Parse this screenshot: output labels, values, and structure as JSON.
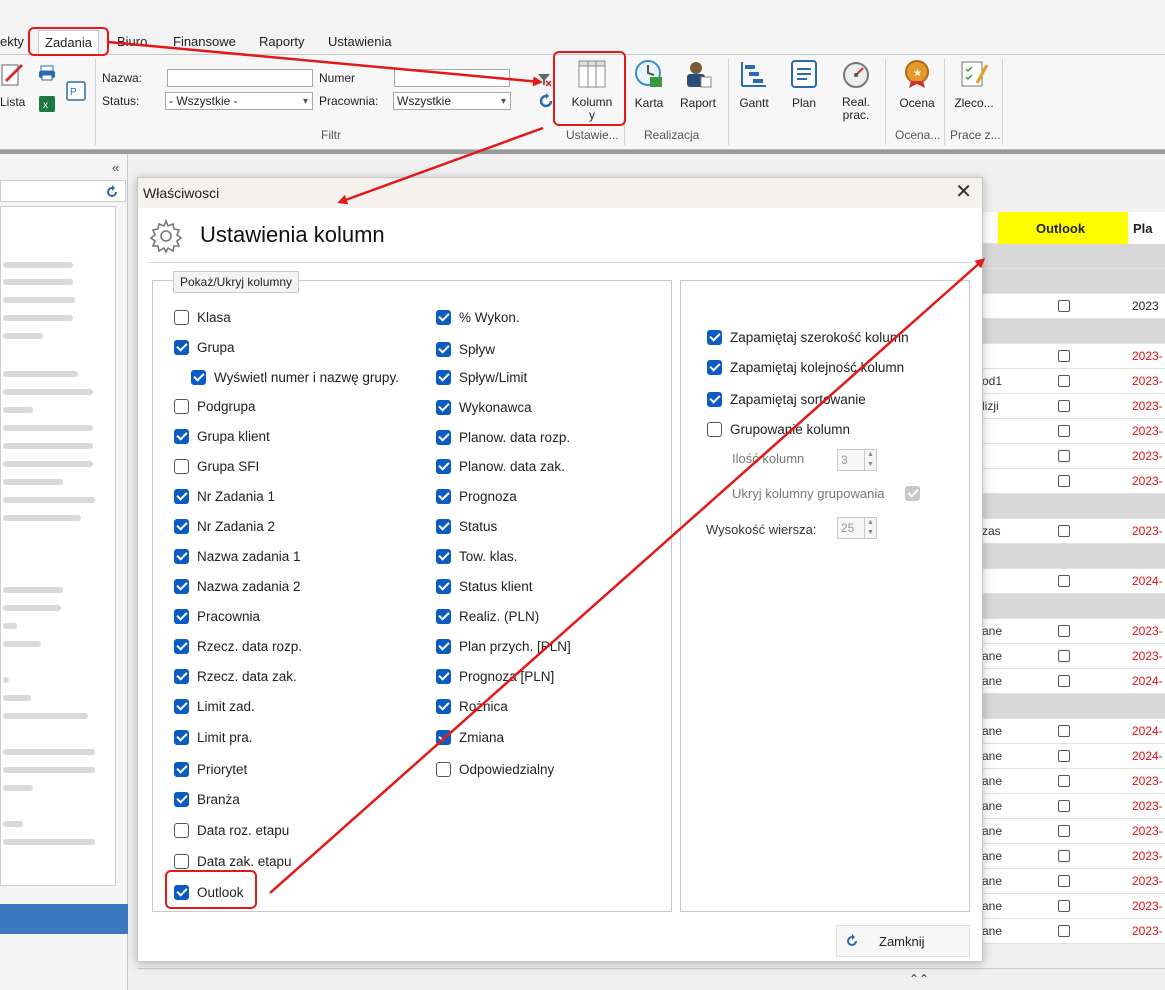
{
  "menu": {
    "tabs": [
      {
        "label": "ekty"
      },
      {
        "label": "Zadania"
      },
      {
        "label": "Biuro"
      },
      {
        "label": "Finansowe"
      },
      {
        "label": "Raporty"
      },
      {
        "label": "Ustawienia"
      }
    ]
  },
  "ribbon": {
    "lista_label": "Lista",
    "filter": {
      "nazwa_label": "Nazwa:",
      "nazwa_value": "",
      "numer_label": "Numer",
      "numer_value": "",
      "status_label": "Status:",
      "status_value": "- Wszystkie -",
      "pracownia_label": "Pracownia:",
      "pracownia_value": "Wszystkie",
      "group_label": "Filtr"
    },
    "buttons": {
      "kolumny": "Kolumn\ny",
      "karta": "Karta",
      "raport": "Raport",
      "gantt": "Gantt",
      "plan": "Plan",
      "real_prac": "Real.\nprac.",
      "ocena": "Ocena",
      "zlecenia": "Zleco..."
    },
    "groups": {
      "ustawienia": "Ustawie...",
      "realizacja": "Realizacja",
      "ocena": "Ocena...",
      "prace": "Prace z..."
    }
  },
  "grid": {
    "header_outlook": "Outlook",
    "header_plan": "Pla",
    "rows": [
      {
        "type": "group",
        "text": "",
        "date": ""
      },
      {
        "type": "group",
        "text": "",
        "date": ""
      },
      {
        "type": "row",
        "text": "",
        "date": "2023",
        "cb": true,
        "date_color": "#222"
      },
      {
        "type": "group",
        "text": "",
        "date": ""
      },
      {
        "type": "row",
        "text": "",
        "date": "2023-",
        "cb": true
      },
      {
        "type": "row",
        "text": "od1",
        "date": "2023-",
        "cb": true
      },
      {
        "type": "row",
        "text": "lizji",
        "date": "2023-",
        "cb": true
      },
      {
        "type": "row",
        "text": "",
        "date": "2023-",
        "cb": true
      },
      {
        "type": "row",
        "text": "",
        "date": "2023-",
        "cb": true
      },
      {
        "type": "row",
        "text": "",
        "date": "2023-",
        "cb": true
      },
      {
        "type": "group",
        "text": "",
        "date": ""
      },
      {
        "type": "row",
        "text": "zas",
        "date": "2023-",
        "cb": true
      },
      {
        "type": "group",
        "text": "",
        "date": ""
      },
      {
        "type": "row",
        "text": "",
        "date": "2024-",
        "cb": true
      },
      {
        "type": "group",
        "text": "",
        "date": ""
      },
      {
        "type": "row",
        "text": "ane",
        "date": "2023-",
        "cb": true
      },
      {
        "type": "row",
        "text": "ane",
        "date": "2023-",
        "cb": true
      },
      {
        "type": "row",
        "text": "ane",
        "date": "2024-",
        "cb": true
      },
      {
        "type": "group",
        "text": "",
        "date": ""
      },
      {
        "type": "row",
        "text": "ane",
        "date": "2024-",
        "cb": true
      },
      {
        "type": "row",
        "text": "ane",
        "date": "2024-",
        "cb": true
      },
      {
        "type": "row",
        "text": "ane",
        "date": "2023-",
        "cb": true
      },
      {
        "type": "row",
        "text": "ane",
        "date": "2023-",
        "cb": true
      },
      {
        "type": "row",
        "text": "ane",
        "date": "2023-",
        "cb": true
      },
      {
        "type": "row",
        "text": "ane",
        "date": "2023-",
        "cb": true
      },
      {
        "type": "row",
        "text": "ane",
        "date": "2023-",
        "cb": true
      },
      {
        "type": "row",
        "text": "ane",
        "date": "2023-",
        "cb": true
      },
      {
        "type": "row",
        "text": "ane",
        "date": "2023-",
        "cb": true
      }
    ]
  },
  "dialog": {
    "title": "Właściwosci",
    "heading": "Ustawienia kolumn",
    "legend": "Pokaż/Ukryj kolumny",
    "col1": [
      {
        "label": "Klasa",
        "checked": false
      },
      {
        "label": "Grupa",
        "checked": true
      },
      {
        "label": "Wyświetl numer i nazwę grupy.",
        "checked": true,
        "indent": true
      },
      {
        "label": "Podgrupa",
        "checked": false
      },
      {
        "label": "Grupa klient",
        "checked": true
      },
      {
        "label": "Grupa SFI",
        "checked": false
      },
      {
        "label": "Nr Zadania 1",
        "checked": true
      },
      {
        "label": "Nr Zadania 2",
        "checked": true
      },
      {
        "label": "Nazwa zadania 1",
        "checked": true
      },
      {
        "label": "Nazwa zadania 2",
        "checked": true
      },
      {
        "label": "Pracownia",
        "checked": true
      },
      {
        "label": "Rzecz. data rozp.",
        "checked": true
      },
      {
        "label": "Rzecz. data zak.",
        "checked": true
      },
      {
        "label": "Limit zad.",
        "checked": true
      },
      {
        "label": "Limit pra.",
        "checked": true
      },
      {
        "label": "Priorytet",
        "checked": true
      },
      {
        "label": "Branża",
        "checked": true
      },
      {
        "label": "Data roz. etapu",
        "checked": false
      },
      {
        "label": "Data zak. etapu",
        "checked": false
      },
      {
        "label": "Outlook",
        "checked": true
      }
    ],
    "col2": [
      {
        "label": "% Wykon.",
        "checked": true
      },
      {
        "label": "Spływ",
        "checked": true
      },
      {
        "label": "Spływ/Limit",
        "checked": true
      },
      {
        "label": "Wykonawca",
        "checked": true
      },
      {
        "label": "Planow. data rozp.",
        "checked": true
      },
      {
        "label": "Planow. data zak.",
        "checked": true
      },
      {
        "label": "Prognoza",
        "checked": true
      },
      {
        "label": "Status",
        "checked": true
      },
      {
        "label": "Tow. klas.",
        "checked": true
      },
      {
        "label": "Status klient",
        "checked": true
      },
      {
        "label": "Realiz. (PLN)",
        "checked": true
      },
      {
        "label": "Plan przych. [PLN]",
        "checked": true
      },
      {
        "label": "Prognoza [PLN]",
        "checked": true
      },
      {
        "label": "Rożnica",
        "checked": true
      },
      {
        "label": "Zmiana",
        "checked": true
      },
      {
        "label": "Odpowiedzialny",
        "checked": false
      }
    ],
    "options": [
      {
        "label": "Zapamiętaj szerokość kolumn",
        "checked": true
      },
      {
        "label": "Zapamiętaj kolejność kolumn",
        "checked": true
      },
      {
        "label": "Zapamiętaj sortowanie",
        "checked": true
      },
      {
        "label": "Grupowanie kolumn",
        "checked": false
      }
    ],
    "ilosc_label": "Ilość kolumn",
    "ilosc_value": "3",
    "ukryj_label": "Ukryj kolumny grupowania",
    "wysokosc_label": "Wysokość wiersza:",
    "wysokosc_value": "25",
    "close_label": "Zamknij"
  },
  "colors": {
    "accent": "#0a5cc2",
    "highlight": "#e21919",
    "outlook_header": "#ffff00",
    "date_red": "#e01010"
  }
}
